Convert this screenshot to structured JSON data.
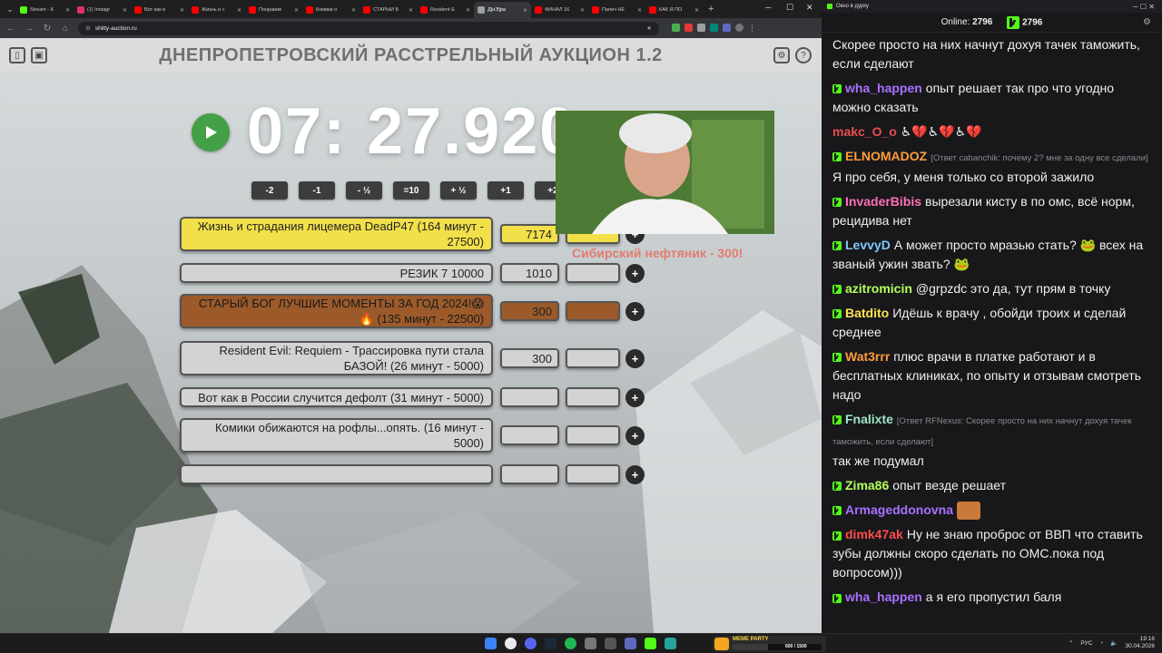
{
  "browser": {
    "tabs": [
      {
        "label": "Stream - K",
        "color": "#53fc18",
        "active": false
      },
      {
        "label": "(1) Instagr",
        "color": "#e1306c",
        "active": false
      },
      {
        "label": "Вот как в",
        "color": "#ff0000",
        "active": false
      },
      {
        "label": "Жизнь и с",
        "color": "#ff0000",
        "active": false
      },
      {
        "label": "Понравив",
        "color": "#ff0000",
        "active": false
      },
      {
        "label": "Комики о",
        "color": "#ff0000",
        "active": false
      },
      {
        "label": "СТАРЫЙ Б",
        "color": "#ff0000",
        "active": false
      },
      {
        "label": "Resident E",
        "color": "#ff0000",
        "active": false
      },
      {
        "label": "Д[нЭ]ра",
        "color": "#9aa0a6",
        "active": true
      },
      {
        "label": "ФИНАЛ 16",
        "color": "#ff0000",
        "active": false
      },
      {
        "label": "Папич НЕ",
        "color": "#ff0000",
        "active": false
      },
      {
        "label": "КАК Я ПО",
        "color": "#ff0000",
        "active": false
      }
    ],
    "url": "shitty-auction.ru"
  },
  "auction": {
    "title": "ДНЕПРОПЕТРОВСКИЙ РАССТРЕЛЬНЫЙ АУКЦИОН 1.2",
    "timer": "07: 27.920",
    "steps": [
      "-2",
      "-1",
      "- ½",
      "=10",
      "+ ½",
      "+1",
      "+2"
    ],
    "lots": [
      {
        "name": "Жизнь и страдания лицемера DeadP47 (164 минут - 27500)",
        "amount": "7174",
        "bg": "#f2e04a",
        "add_bg": "#f2e04a"
      },
      {
        "name": "РЕЗИК 7 10000",
        "amount": "1010",
        "bg": "#d3d3d3",
        "add_bg": "#d3d3d3"
      },
      {
        "name": "СТАРЫЙ БОГ ЛУЧШИЕ МОМЕНТЫ ЗА ГОД 2024!😱🔥 (135 минут - 22500)",
        "amount": "300",
        "bg": "#9c5a2a",
        "add_bg": "#9c5a2a"
      },
      {
        "name": "Resident Evil: Requiem - Трассировка пути стала БАЗОЙ! (26 минут - 5000)",
        "amount": "300",
        "bg": "#d3d3d3",
        "add_bg": "#d3d3d3"
      },
      {
        "name": "Вот как в России случится дефолт (31 минут - 5000)",
        "amount": "",
        "bg": "#d3d3d3",
        "add_bg": "#d3d3d3"
      },
      {
        "name": "Комики обижаются на рофлы...опять. (16 минут - 5000)",
        "amount": "",
        "bg": "#d3d3d3",
        "add_bg": "#d3d3d3"
      },
      {
        "name": "",
        "amount": "",
        "bg": "#d3d3d3",
        "add_bg": "#d3d3d3"
      }
    ],
    "overlay_text": "Сибирский нефтяник - 300!"
  },
  "chat": {
    "window_title": "Окно в дурку",
    "online_label": "Online:",
    "online_count": "2796",
    "viewer_count": "2796",
    "messages": [
      {
        "user": "",
        "color": "#efeff1",
        "text": "Скорее просто на них начнут дохуя тачек таможить, если сделают",
        "reply": "",
        "badge": false
      },
      {
        "user": "wha_happen",
        "color": "#a970ff",
        "text": "опыт решает так про что угодно можно сказать",
        "reply": "",
        "badge": true
      },
      {
        "user": "makc_O_o",
        "color": "#e94e4e",
        "text": "♿💔♿💔♿💔",
        "reply": "",
        "badge": false
      },
      {
        "user": "ELNOMADOZ",
        "color": "#ff9d3b",
        "text": "Я про себя, у меня только со второй зажило",
        "reply": "[Ответ cabanchik: почему 2? мне за одну все сделали]",
        "badge": true
      },
      {
        "user": "InvaderBibis",
        "color": "#ff6fb5",
        "text": "вырезали кисту в по омс, всё норм, рецидива нет",
        "reply": "",
        "badge": true
      },
      {
        "user": "LevvyD",
        "color": "#7ec8ff",
        "text": "А может просто мразью стать? 🐸 всех на званый ужин звать? 🐸",
        "reply": "",
        "badge": true
      },
      {
        "user": "azitromicin",
        "color": "#b6ff5c",
        "text": "@grpzdc это да, тут прям в точку",
        "reply": "",
        "badge": true
      },
      {
        "user": "Batdito",
        "color": "#ffe34d",
        "text": "Идёшь к врачу , обойди троих и сделай среднее",
        "reply": "",
        "badge": true
      },
      {
        "user": "Wat3rrr",
        "color": "#ff9d3b",
        "text": "плюс врачи в платке работают и в бесплатных клиниках, по опыту и отзывам смотреть надо",
        "reply": "",
        "badge": true
      },
      {
        "user": "Fnalixte",
        "color": "#9be7c4",
        "text": "так же подумал",
        "reply": "[Ответ RFNexus: Скорее просто на них начнут дохуя тачек таможить, если сделают]",
        "badge": true
      },
      {
        "user": "Zima86",
        "color": "#b6ff5c",
        "text": "опыт везде решает",
        "reply": "",
        "badge": true
      },
      {
        "user": "Armageddonovna",
        "color": "#a970ff",
        "text": "",
        "reply": "",
        "badge": true
      },
      {
        "user": "dimk47ak",
        "color": "#ff4b4b",
        "text": "Ну не знаю проброс от ВВП что ставить зубы должны скоро сделать по ОМС.пока под вопросом)))",
        "reply": "",
        "badge": true
      },
      {
        "user": "wha_happen",
        "color": "#a970ff",
        "text": "а я его пропустил баля",
        "reply": "",
        "badge": true
      }
    ]
  },
  "taskbar": {
    "meme_label": "MEME PARTY",
    "meme_progress": "600 / 1500",
    "lang": "РУС",
    "time": "19:16",
    "date": "30.04.2026"
  }
}
